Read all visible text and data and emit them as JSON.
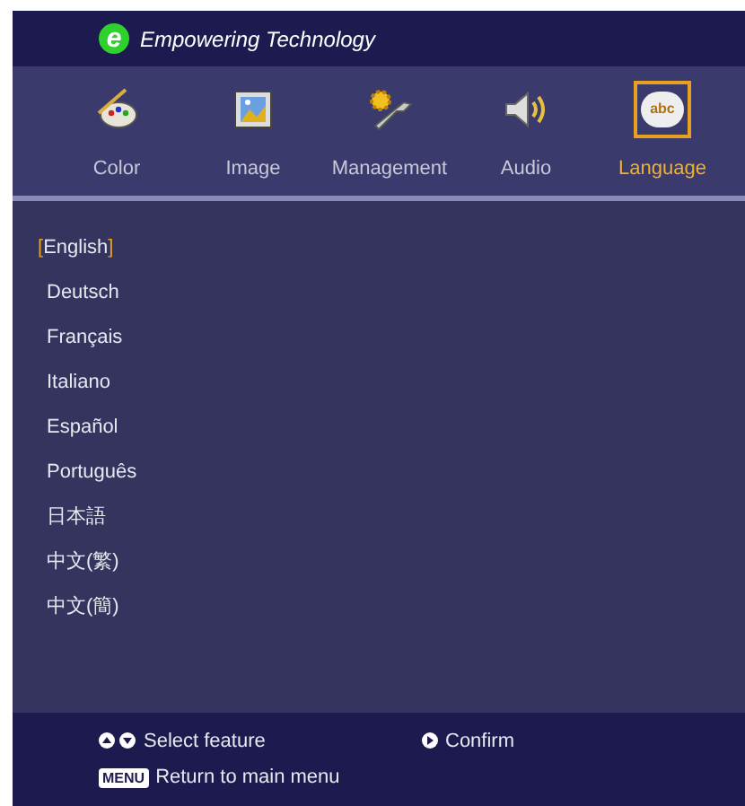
{
  "header": {
    "title": "Empowering Technology",
    "logo_letter": "e"
  },
  "tabs": [
    {
      "label": "Color",
      "kind": "palette",
      "selected": false
    },
    {
      "label": "Image",
      "kind": "image",
      "selected": false
    },
    {
      "label": "Management",
      "kind": "tools",
      "selected": false
    },
    {
      "label": "Audio",
      "kind": "speaker",
      "selected": false
    },
    {
      "label": "Language",
      "kind": "bubble",
      "icon_text": "abc",
      "selected": true
    }
  ],
  "languages": {
    "selection_marks": [
      "[",
      "]"
    ],
    "items": [
      {
        "label": "English",
        "selected": true
      },
      {
        "label": "Deutsch",
        "selected": false
      },
      {
        "label": "Français",
        "selected": false
      },
      {
        "label": "Italiano",
        "selected": false
      },
      {
        "label": "Español",
        "selected": false
      },
      {
        "label": "Português",
        "selected": false
      },
      {
        "label": "日本語",
        "selected": false
      },
      {
        "label": "中文(繁)",
        "selected": false
      },
      {
        "label": "中文(簡)",
        "selected": false
      }
    ]
  },
  "footer": {
    "hints": [
      {
        "kind": "updown",
        "text": "Select feature"
      },
      {
        "kind": "right",
        "text": "Confirm"
      },
      {
        "kind": "key",
        "key": "MENU",
        "text": "Return to main menu"
      }
    ]
  }
}
